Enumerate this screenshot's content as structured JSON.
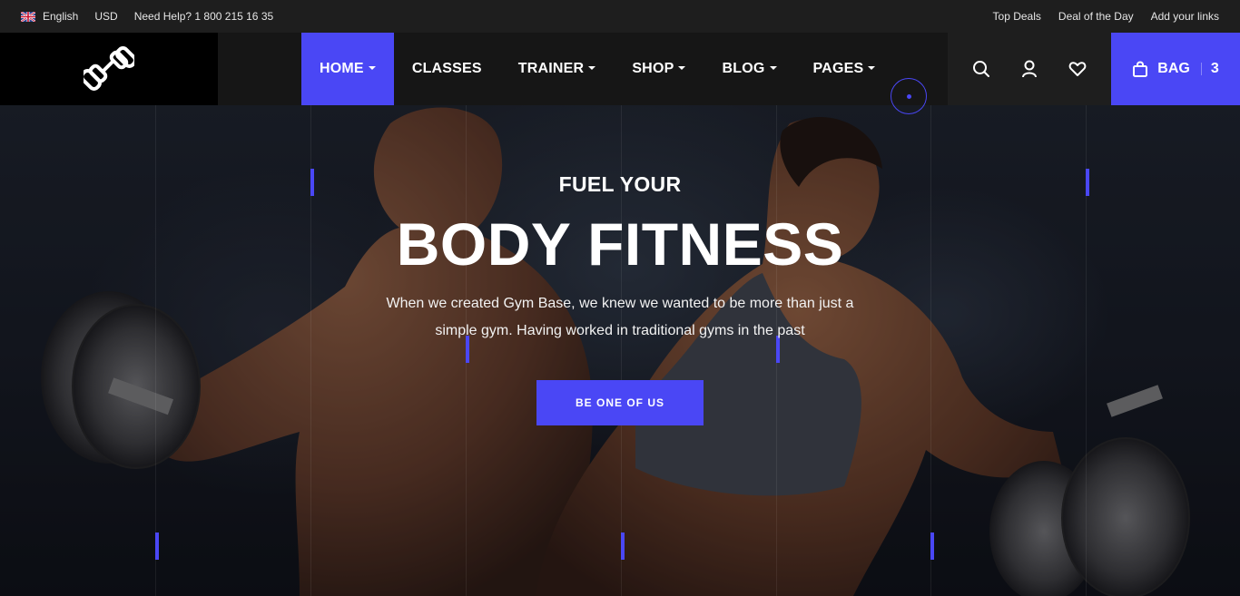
{
  "topbar": {
    "language": "English",
    "currency": "USD",
    "help": "Need Help? 1 800 215 16 35",
    "links": [
      "Top Deals",
      "Deal of the Day",
      "Add your links"
    ]
  },
  "nav": {
    "items": [
      {
        "label": "HOME",
        "active": true,
        "dropdown": true
      },
      {
        "label": "CLASSES",
        "active": false,
        "dropdown": false
      },
      {
        "label": "TRAINER",
        "active": false,
        "dropdown": true
      },
      {
        "label": "SHOP",
        "active": false,
        "dropdown": true
      },
      {
        "label": "BLOG",
        "active": false,
        "dropdown": true
      },
      {
        "label": "PAGES",
        "active": false,
        "dropdown": true
      }
    ],
    "icons": [
      "search-icon",
      "user-icon",
      "heart-icon"
    ],
    "bag_label": "BAG",
    "bag_count": "3"
  },
  "hero": {
    "kicker": "FUEL YOUR",
    "headline": "BODY FITNESS",
    "description": "When we created Gym Base, we knew we wanted to be more than just a simple gym. Having worked in traditional gyms in the past",
    "cta": "BE ONE OF US"
  },
  "colors": {
    "accent": "#4a47f5",
    "topbar_bg": "#1e1e1e",
    "nav_bg": "#161616"
  }
}
